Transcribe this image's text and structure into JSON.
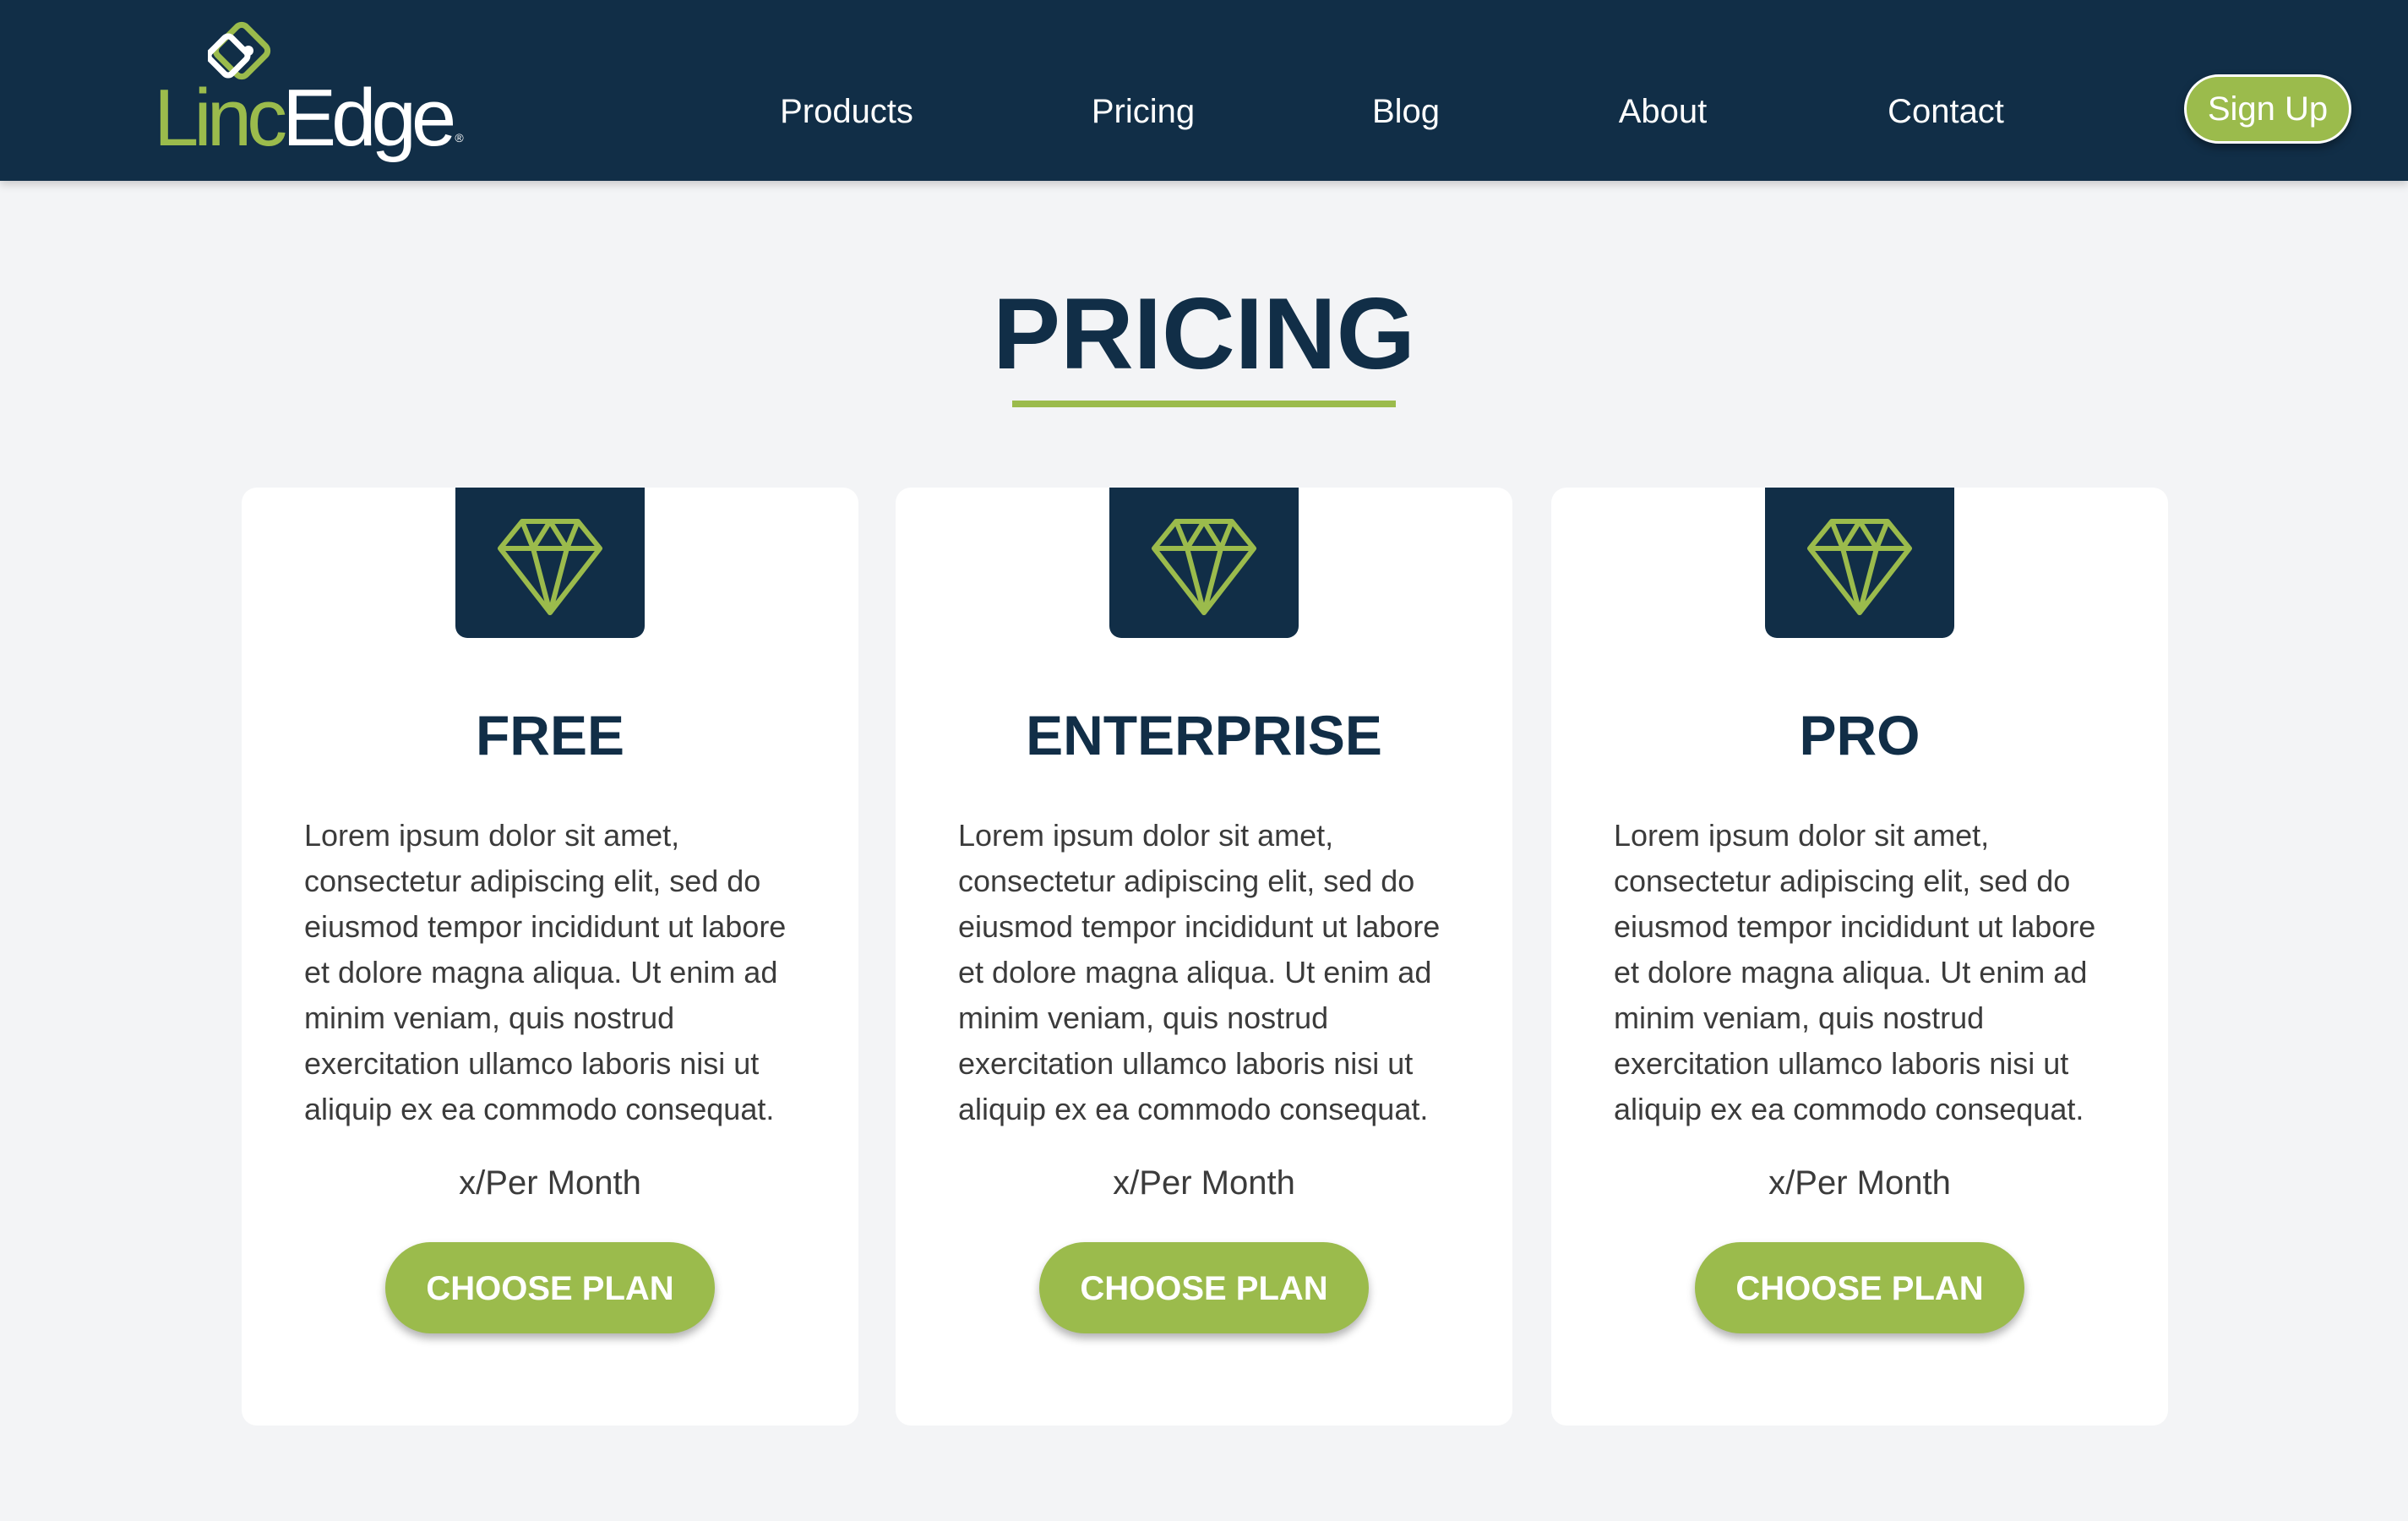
{
  "header": {
    "logo": {
      "part1": "Linc",
      "part2": "Edge",
      "mark": "®"
    },
    "nav": [
      "Products",
      "Pricing",
      "Blog",
      "About",
      "Contact"
    ],
    "signup_label": "Sign Up"
  },
  "main": {
    "title": "PRICING",
    "plans": [
      {
        "name": "FREE",
        "description": "Lorem ipsum dolor sit amet, consectetur adipiscing elit, sed do eiusmod tempor incididunt ut labore et dolore magna aliqua. Ut enim ad minim veniam, quis nostrud exercitation ullamco laboris nisi ut aliquip ex ea commodo consequat.",
        "price": "x/Per Month",
        "cta": "CHOOSE PLAN",
        "icon": "diamond-icon"
      },
      {
        "name": "ENTERPRISE",
        "description": "Lorem ipsum dolor sit amet, consectetur adipiscing elit, sed do eiusmod tempor incididunt ut labore et dolore magna aliqua. Ut enim ad minim veniam, quis nostrud exercitation ullamco laboris nisi ut aliquip ex ea commodo consequat.",
        "price": "x/Per Month",
        "cta": "CHOOSE PLAN",
        "icon": "diamond-icon"
      },
      {
        "name": "PRO",
        "description": "Lorem ipsum dolor sit amet, consectetur adipiscing elit, sed do eiusmod tempor incididunt ut labore et dolore magna aliqua. Ut enim ad minim veniam, quis nostrud exercitation ullamco laboris nisi ut aliquip ex ea commodo consequat.",
        "price": "x/Per Month",
        "cta": "CHOOSE PLAN",
        "icon": "diamond-icon"
      }
    ]
  },
  "colors": {
    "navy": "#112e47",
    "accent_green": "#9bbb4c",
    "background": "#f3f4f6",
    "card": "#ffffff",
    "body_text": "#3b3b3b"
  }
}
